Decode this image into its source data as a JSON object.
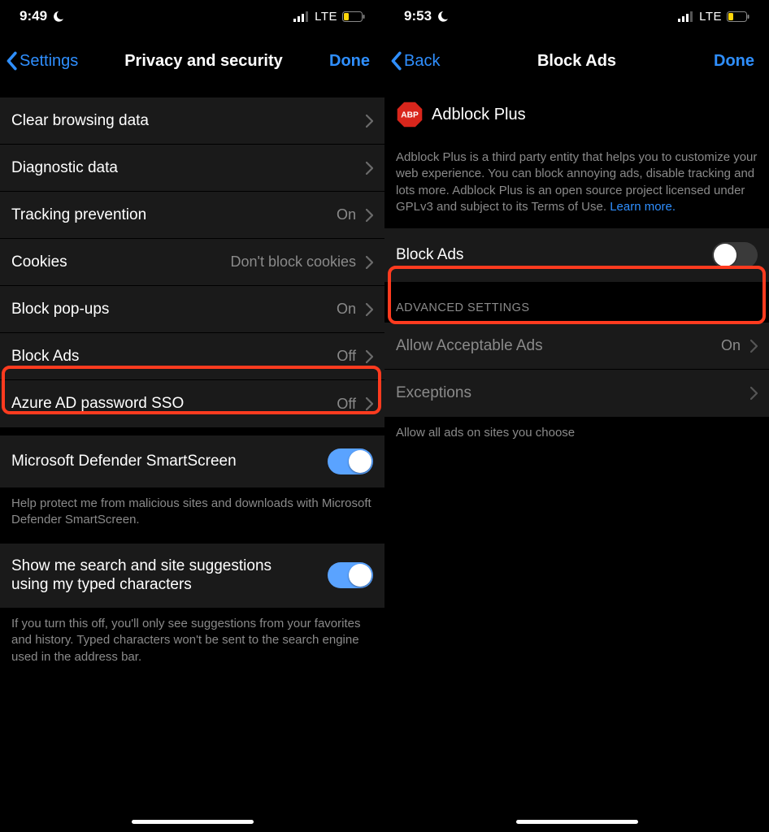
{
  "left": {
    "status": {
      "time": "9:49",
      "net": "LTE"
    },
    "nav": {
      "back": "Settings",
      "title": "Privacy and security",
      "done": "Done"
    },
    "rows": {
      "clear": {
        "label": "Clear browsing data"
      },
      "diag": {
        "label": "Diagnostic data"
      },
      "track": {
        "label": "Tracking prevention",
        "value": "On"
      },
      "cookies": {
        "label": "Cookies",
        "value": "Don't block cookies"
      },
      "popups": {
        "label": "Block pop-ups",
        "value": "On"
      },
      "blockads": {
        "label": "Block Ads",
        "value": "Off"
      },
      "azure": {
        "label": "Azure AD password SSO",
        "value": "Off"
      },
      "smartscreen": {
        "label": "Microsoft Defender SmartScreen"
      },
      "suggestions": {
        "label": "Show me search and site suggestions using my typed characters"
      }
    },
    "footers": {
      "smartscreen": "Help protect me from malicious sites and downloads with Microsoft Defender SmartScreen.",
      "suggestions": "If you turn this off, you'll only see suggestions from your favorites and history. Typed characters won't be sent to the search engine used in the address bar."
    }
  },
  "right": {
    "status": {
      "time": "9:53",
      "net": "LTE"
    },
    "nav": {
      "back": "Back",
      "title": "Block Ads",
      "done": "Done"
    },
    "header": {
      "abp_label": "Adblock Plus"
    },
    "desc": {
      "body": "Adblock Plus is a third party entity that helps you to customize your web experience. You can block annoying ads, disable tracking and lots more. Adblock Plus is an open source project licensed under GPLv3 and subject to its Terms of Use. ",
      "learn_more": "Learn more."
    },
    "rows": {
      "blockads": {
        "label": "Block Ads"
      },
      "advanced_header": "ADVANCED SETTINGS",
      "allow_acceptable": {
        "label": "Allow Acceptable Ads",
        "value": "On"
      },
      "exceptions": {
        "label": "Exceptions"
      }
    },
    "footer": "Allow all ads on sites you choose"
  }
}
